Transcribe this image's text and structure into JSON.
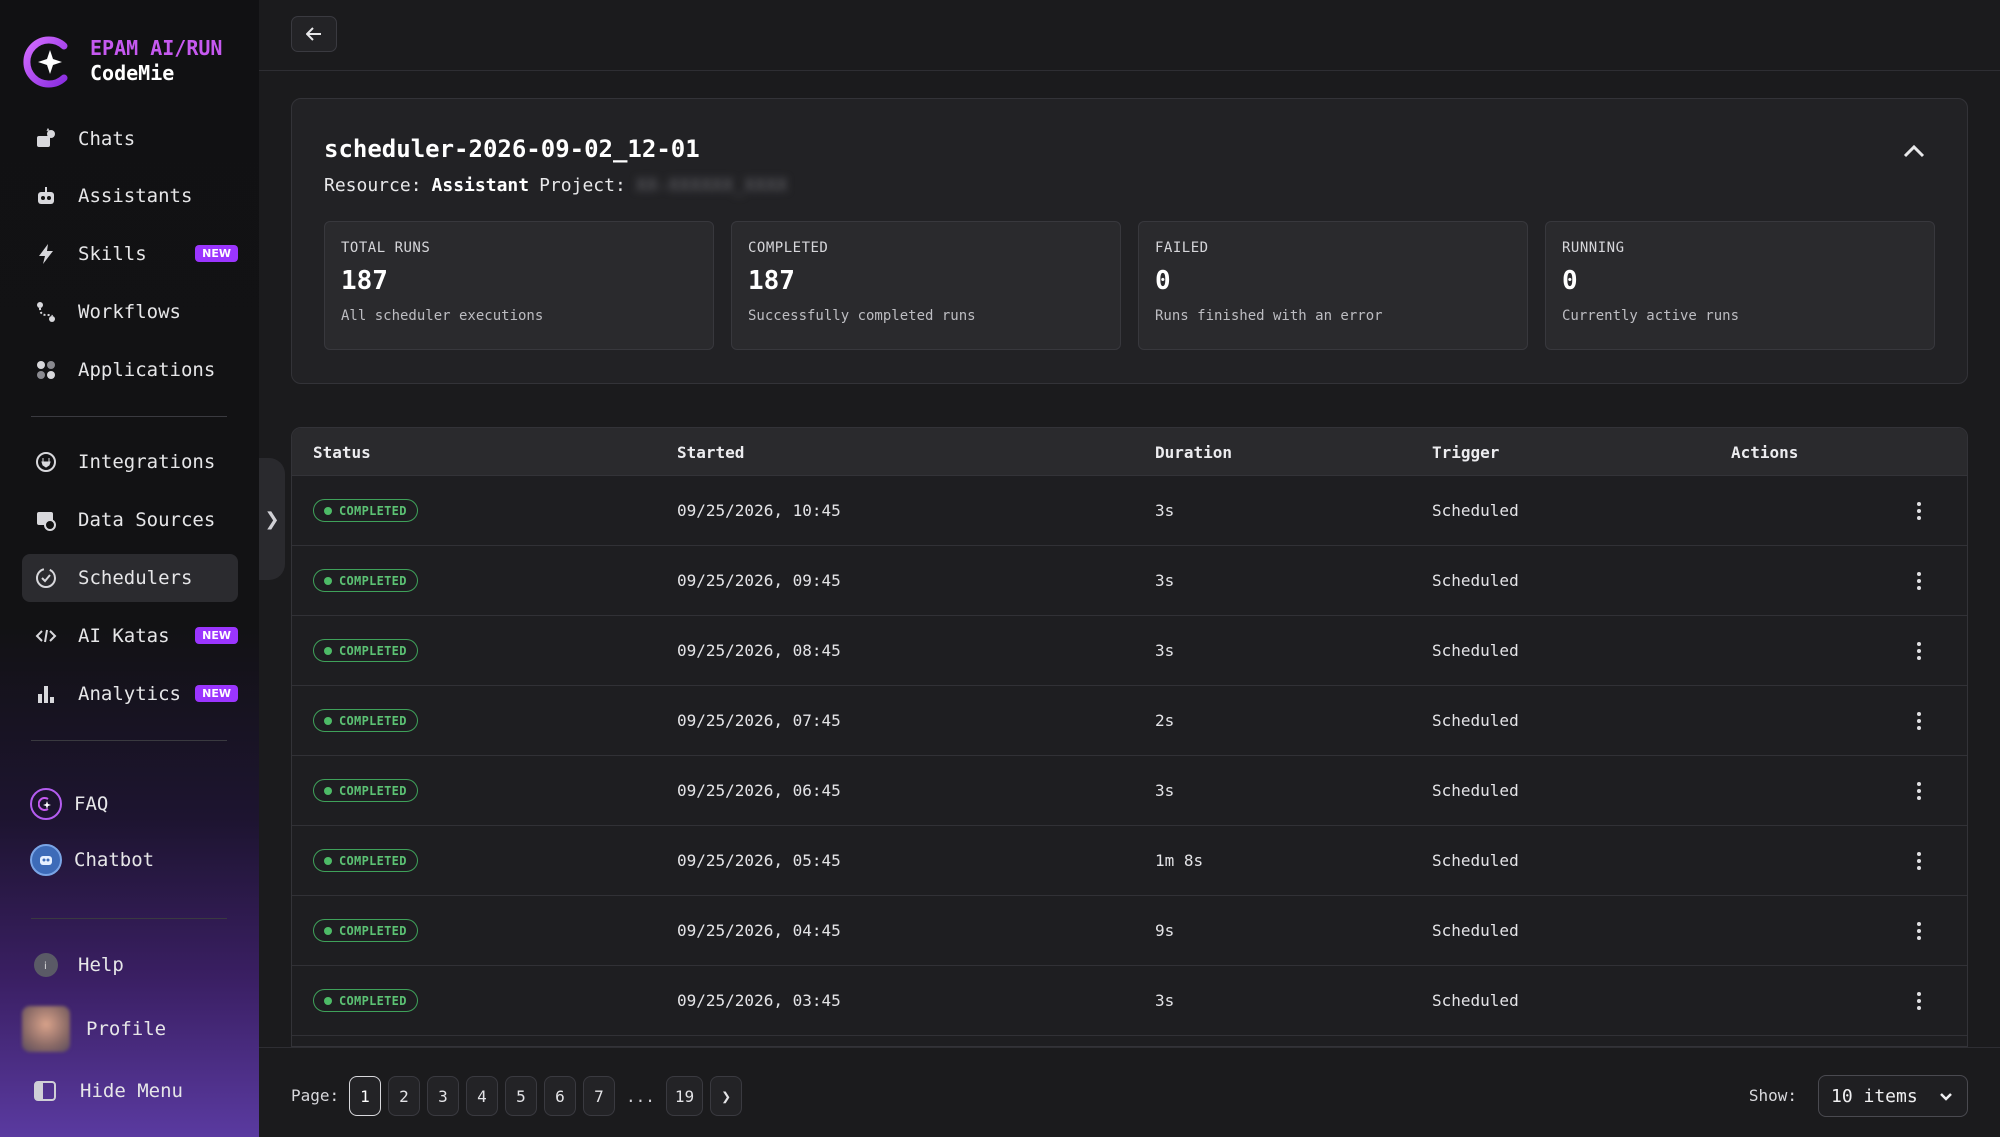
{
  "brand": {
    "line1": "EPAM AI/RUN",
    "line2": "CodeMie",
    "accent": "#c659f0"
  },
  "sidebar": {
    "items": [
      {
        "label": "Chats",
        "icon": "chats-icon"
      },
      {
        "label": "Assistants",
        "icon": "robot-icon"
      },
      {
        "label": "Skills",
        "icon": "bolt-icon",
        "badge": "NEW"
      },
      {
        "label": "Workflows",
        "icon": "workflow-icon"
      },
      {
        "label": "Applications",
        "icon": "apps-icon"
      },
      {
        "label": "Integrations",
        "icon": "plug-icon"
      },
      {
        "label": "Data Sources",
        "icon": "database-icon"
      },
      {
        "label": "Schedulers",
        "icon": "clock-check-icon",
        "active": true
      },
      {
        "label": "AI Katas",
        "icon": "code-icon",
        "badge": "NEW"
      },
      {
        "label": "Analytics",
        "icon": "bar-chart-icon",
        "badge": "NEW"
      }
    ],
    "faq": "FAQ",
    "chatbot": "Chatbot",
    "help": "Help",
    "profile": "Profile",
    "hide_menu": "Hide Menu"
  },
  "scheduler": {
    "title": "scheduler-2026-09-02_12-01",
    "resource_label": "Resource:",
    "resource_value": "Assistant",
    "project_label": "Project:",
    "project_value": "XX-XXXXXX_XXXX"
  },
  "stats": [
    {
      "title": "TOTAL RUNS",
      "value": "187",
      "desc": "All scheduler executions"
    },
    {
      "title": "COMPLETED",
      "value": "187",
      "desc": "Successfully completed runs"
    },
    {
      "title": "FAILED",
      "value": "0",
      "desc": "Runs finished with an error"
    },
    {
      "title": "RUNNING",
      "value": "0",
      "desc": "Currently active runs"
    }
  ],
  "table": {
    "headers": {
      "status": "Status",
      "started": "Started",
      "duration": "Duration",
      "trigger": "Trigger",
      "actions": "Actions"
    },
    "rows": [
      {
        "status": "COMPLETED",
        "started": "09/25/2026, 10:45",
        "duration": "3s",
        "trigger": "Scheduled"
      },
      {
        "status": "COMPLETED",
        "started": "09/25/2026, 09:45",
        "duration": "3s",
        "trigger": "Scheduled"
      },
      {
        "status": "COMPLETED",
        "started": "09/25/2026, 08:45",
        "duration": "3s",
        "trigger": "Scheduled"
      },
      {
        "status": "COMPLETED",
        "started": "09/25/2026, 07:45",
        "duration": "2s",
        "trigger": "Scheduled"
      },
      {
        "status": "COMPLETED",
        "started": "09/25/2026, 06:45",
        "duration": "3s",
        "trigger": "Scheduled"
      },
      {
        "status": "COMPLETED",
        "started": "09/25/2026, 05:45",
        "duration": "1m 8s",
        "trigger": "Scheduled"
      },
      {
        "status": "COMPLETED",
        "started": "09/25/2026, 04:45",
        "duration": "9s",
        "trigger": "Scheduled"
      },
      {
        "status": "COMPLETED",
        "started": "09/25/2026, 03:45",
        "duration": "3s",
        "trigger": "Scheduled"
      }
    ]
  },
  "pagination": {
    "label": "Page:",
    "pages": [
      "1",
      "2",
      "3",
      "4",
      "5",
      "6",
      "7"
    ],
    "ellipsis": "...",
    "last": "19",
    "next": "❯",
    "current": "1",
    "show_label": "Show:",
    "show_value": "10 items"
  }
}
